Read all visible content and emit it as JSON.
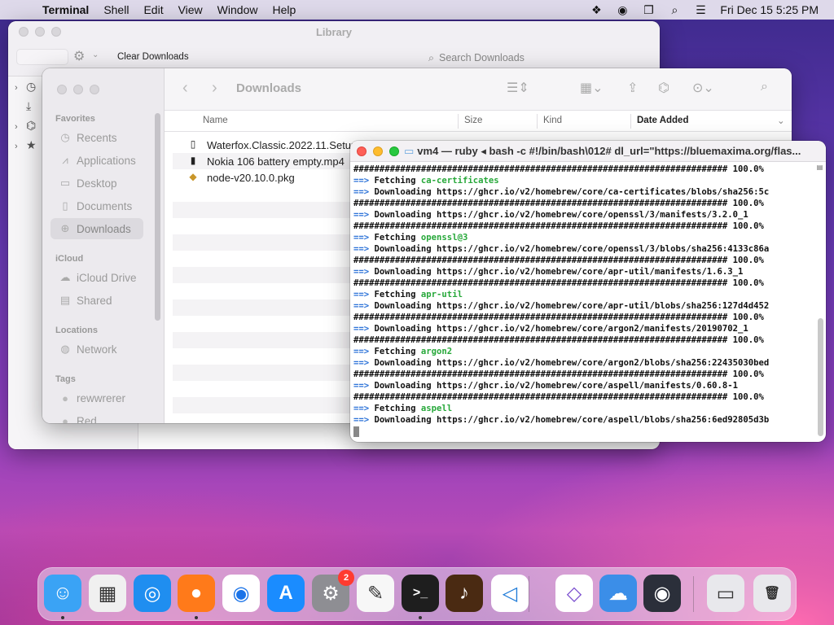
{
  "menubar": {
    "app": "Terminal",
    "menus": [
      "Shell",
      "Edit",
      "View",
      "Window",
      "Help"
    ],
    "clock": "Fri Dec 15  5:25 PM",
    "status_icons": [
      "dropbox-icon",
      "record-icon",
      "screen-mirror-icon",
      "spotlight-icon",
      "control-center-icon"
    ]
  },
  "library": {
    "title": "Library",
    "clear_label": "Clear Downloads",
    "search_placeholder": "Search Downloads"
  },
  "finder": {
    "title": "Downloads",
    "sections": {
      "favorites": "Favorites",
      "icloud": "iCloud",
      "locations": "Locations",
      "tags": "Tags"
    },
    "favorites": [
      "Recents",
      "Applications",
      "Desktop",
      "Documents",
      "Downloads"
    ],
    "icloud_items": [
      "iCloud Drive",
      "Shared"
    ],
    "locations_items": [
      "Network"
    ],
    "tags_items": [
      "rewwrerer",
      "Red"
    ],
    "columns": {
      "name": "Name",
      "size": "Size",
      "kind": "Kind",
      "date": "Date Added"
    },
    "files": [
      "Waterfox.Classic.2022.11.Setup",
      "Nokia 106 battery empty.mp4",
      "node-v20.10.0.pkg"
    ]
  },
  "terminal": {
    "title": "vm4 — ruby ◂ bash -c #!/bin/bash\\012# dl_url=\"https://bluemaxima.org/flas...",
    "progress": "######################################################################## 100.0%",
    "lines": [
      {
        "t": "p"
      },
      {
        "t": "f",
        "text": "Fetching ",
        "pkg": "ca-certificates"
      },
      {
        "t": "d",
        "text": "Downloading https://ghcr.io/v2/homebrew/core/ca-certificates/blobs/sha256:5c"
      },
      {
        "t": "p"
      },
      {
        "t": "d",
        "text": "Downloading https://ghcr.io/v2/homebrew/core/openssl/3/manifests/3.2.0_1"
      },
      {
        "t": "p"
      },
      {
        "t": "f",
        "text": "Fetching ",
        "pkg": "openssl@3"
      },
      {
        "t": "d",
        "text": "Downloading https://ghcr.io/v2/homebrew/core/openssl/3/blobs/sha256:4133c86a"
      },
      {
        "t": "p"
      },
      {
        "t": "d",
        "text": "Downloading https://ghcr.io/v2/homebrew/core/apr-util/manifests/1.6.3_1"
      },
      {
        "t": "p"
      },
      {
        "t": "f",
        "text": "Fetching ",
        "pkg": "apr-util"
      },
      {
        "t": "d",
        "text": "Downloading https://ghcr.io/v2/homebrew/core/apr-util/blobs/sha256:127d4d452"
      },
      {
        "t": "p"
      },
      {
        "t": "d",
        "text": "Downloading https://ghcr.io/v2/homebrew/core/argon2/manifests/20190702_1"
      },
      {
        "t": "p"
      },
      {
        "t": "f",
        "text": "Fetching ",
        "pkg": "argon2"
      },
      {
        "t": "d",
        "text": "Downloading https://ghcr.io/v2/homebrew/core/argon2/blobs/sha256:22435030bed"
      },
      {
        "t": "p"
      },
      {
        "t": "d",
        "text": "Downloading https://ghcr.io/v2/homebrew/core/aspell/manifests/0.60.8-1"
      },
      {
        "t": "p"
      },
      {
        "t": "f",
        "text": "Fetching ",
        "pkg": "aspell"
      },
      {
        "t": "d",
        "text": "Downloading https://ghcr.io/v2/homebrew/core/aspell/blobs/sha256:6ed92805d3b"
      }
    ],
    "arrow": "==>"
  },
  "dock": {
    "apps": [
      {
        "name": "finder",
        "color": "#3aa3f5",
        "glyph": "☺",
        "running": true
      },
      {
        "name": "launchpad",
        "color": "#f0f0f0",
        "glyph": "▦",
        "running": false
      },
      {
        "name": "safari",
        "color": "#1f8ef0",
        "glyph": "◎",
        "running": false
      },
      {
        "name": "firefox",
        "color": "#ff7a1a",
        "glyph": "●",
        "running": true
      },
      {
        "name": "chrome",
        "color": "#ffffff",
        "glyph": "◉",
        "running": false
      },
      {
        "name": "app-store",
        "color": "#1a8cff",
        "glyph": "A",
        "running": false
      },
      {
        "name": "system-settings",
        "color": "#8e8e93",
        "glyph": "⚙",
        "running": false
      },
      {
        "name": "textedit",
        "color": "#f7f7f7",
        "glyph": "✎",
        "running": false
      },
      {
        "name": "terminal",
        "color": "#1e1e1e",
        "glyph": ">_",
        "running": true
      },
      {
        "name": "garageband",
        "color": "#4a2a12",
        "glyph": "♪",
        "running": false
      },
      {
        "name": "vscode",
        "color": "#ffffff",
        "glyph": "◁",
        "running": false
      },
      {
        "name": "visual-studio",
        "color": "#ffffff",
        "glyph": "◇",
        "running": false
      },
      {
        "name": "weather",
        "color": "#3b8ee8",
        "glyph": "☁",
        "running": false
      },
      {
        "name": "obs",
        "color": "#2b2f3a",
        "glyph": "◉",
        "running": false
      },
      {
        "name": "recent-window",
        "color": "#e8e8ec",
        "glyph": "▭",
        "running": false
      },
      {
        "name": "trash",
        "color": "#e8e8ec",
        "glyph": "🗑",
        "running": false
      }
    ],
    "settings_badge": "2"
  }
}
